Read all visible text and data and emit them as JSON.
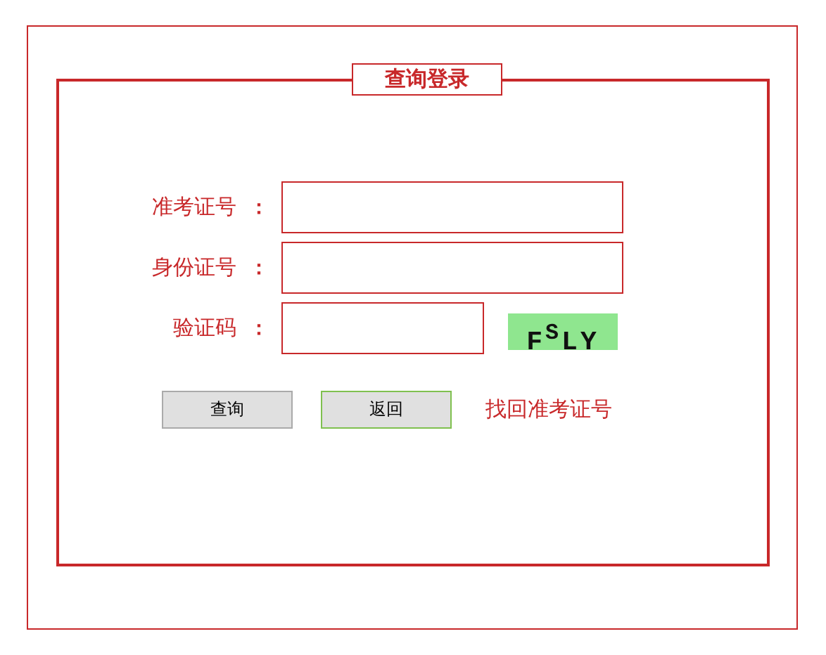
{
  "panel": {
    "title": "查询登录"
  },
  "fields": [
    {
      "label": "准考证号",
      "colon": "：",
      "kind": "text"
    },
    {
      "label": "身份证号",
      "colon": "：",
      "kind": "text"
    },
    {
      "label": "验证码",
      "colon": "：",
      "kind": "captcha",
      "captcha": "F$^{S}$LY"
    }
  ],
  "buttons": [
    "查询",
    "返回"
  ],
  "link": "找回准考证号"
}
